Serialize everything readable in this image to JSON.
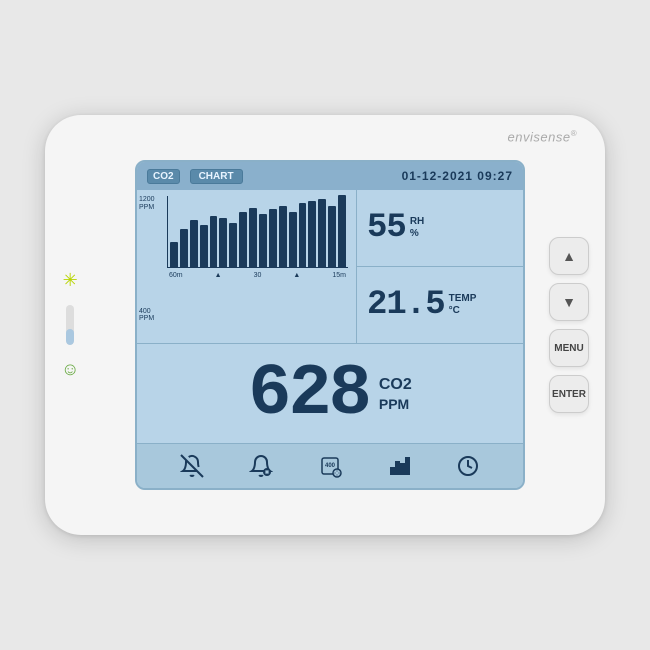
{
  "brand": {
    "name": "envisense",
    "trademark": "®"
  },
  "screen": {
    "co2_badge": "CO2",
    "chart_badge": "CHART",
    "datetime": "01-12-2021  09:27",
    "humidity": {
      "value": "55",
      "unit": "RH",
      "symbol": "%"
    },
    "temperature": {
      "value": "21.5",
      "unit": "TEMP",
      "symbol": "°C"
    },
    "co2": {
      "value": "628",
      "label": "CO2",
      "unit": "PPM"
    },
    "chart": {
      "y_labels": [
        "1200\nPPM",
        "400\nPPM"
      ],
      "x_labels": [
        "60m",
        "30",
        "15m"
      ],
      "bars": [
        30,
        45,
        55,
        50,
        60,
        58,
        52,
        65,
        70,
        62,
        68,
        72,
        65,
        75,
        78,
        80,
        72,
        85
      ]
    }
  },
  "buttons": {
    "up": "▲",
    "down": "▼",
    "menu": "MENU",
    "enter": "ENTER"
  },
  "indicators": {
    "sun_color": "#b8d400",
    "face_color": "#6aaa44"
  },
  "bottom_icons": {
    "alarm_off": "alarm-off-icon",
    "alarm_on": "alarm-on-icon",
    "calibrate": "calibrate-icon",
    "chart_small": "chart-icon",
    "clock": "clock-icon"
  }
}
